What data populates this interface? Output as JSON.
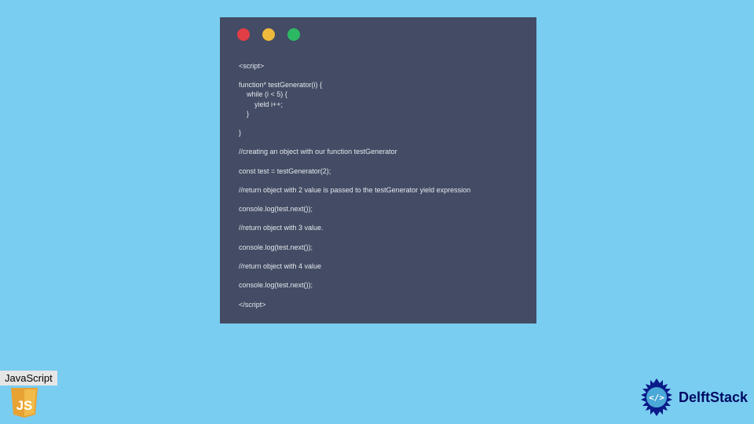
{
  "code_window": {
    "dots": [
      "red",
      "yellow",
      "green"
    ],
    "lines": [
      "<script>",
      "",
      "function* testGenerator(i) {",
      "    while (i < 5) {",
      "        yield i++;",
      "    }",
      "",
      "}",
      "",
      "//creating an object with our function testGenerator",
      "",
      "const test = testGenerator(2);",
      "",
      "//return object with 2 value is passed to the testGenerator yield expression",
      "",
      "console.log(test.next());",
      "",
      "//return object with 3 value.",
      "",
      "console.log(test.next());",
      "",
      "//return object with 4 value",
      "",
      "console.log(test.next());",
      "",
      "</script>"
    ]
  },
  "js_badge": {
    "label": "JavaScript",
    "logo_text": "JS"
  },
  "delft": {
    "text": "DelftStack"
  }
}
